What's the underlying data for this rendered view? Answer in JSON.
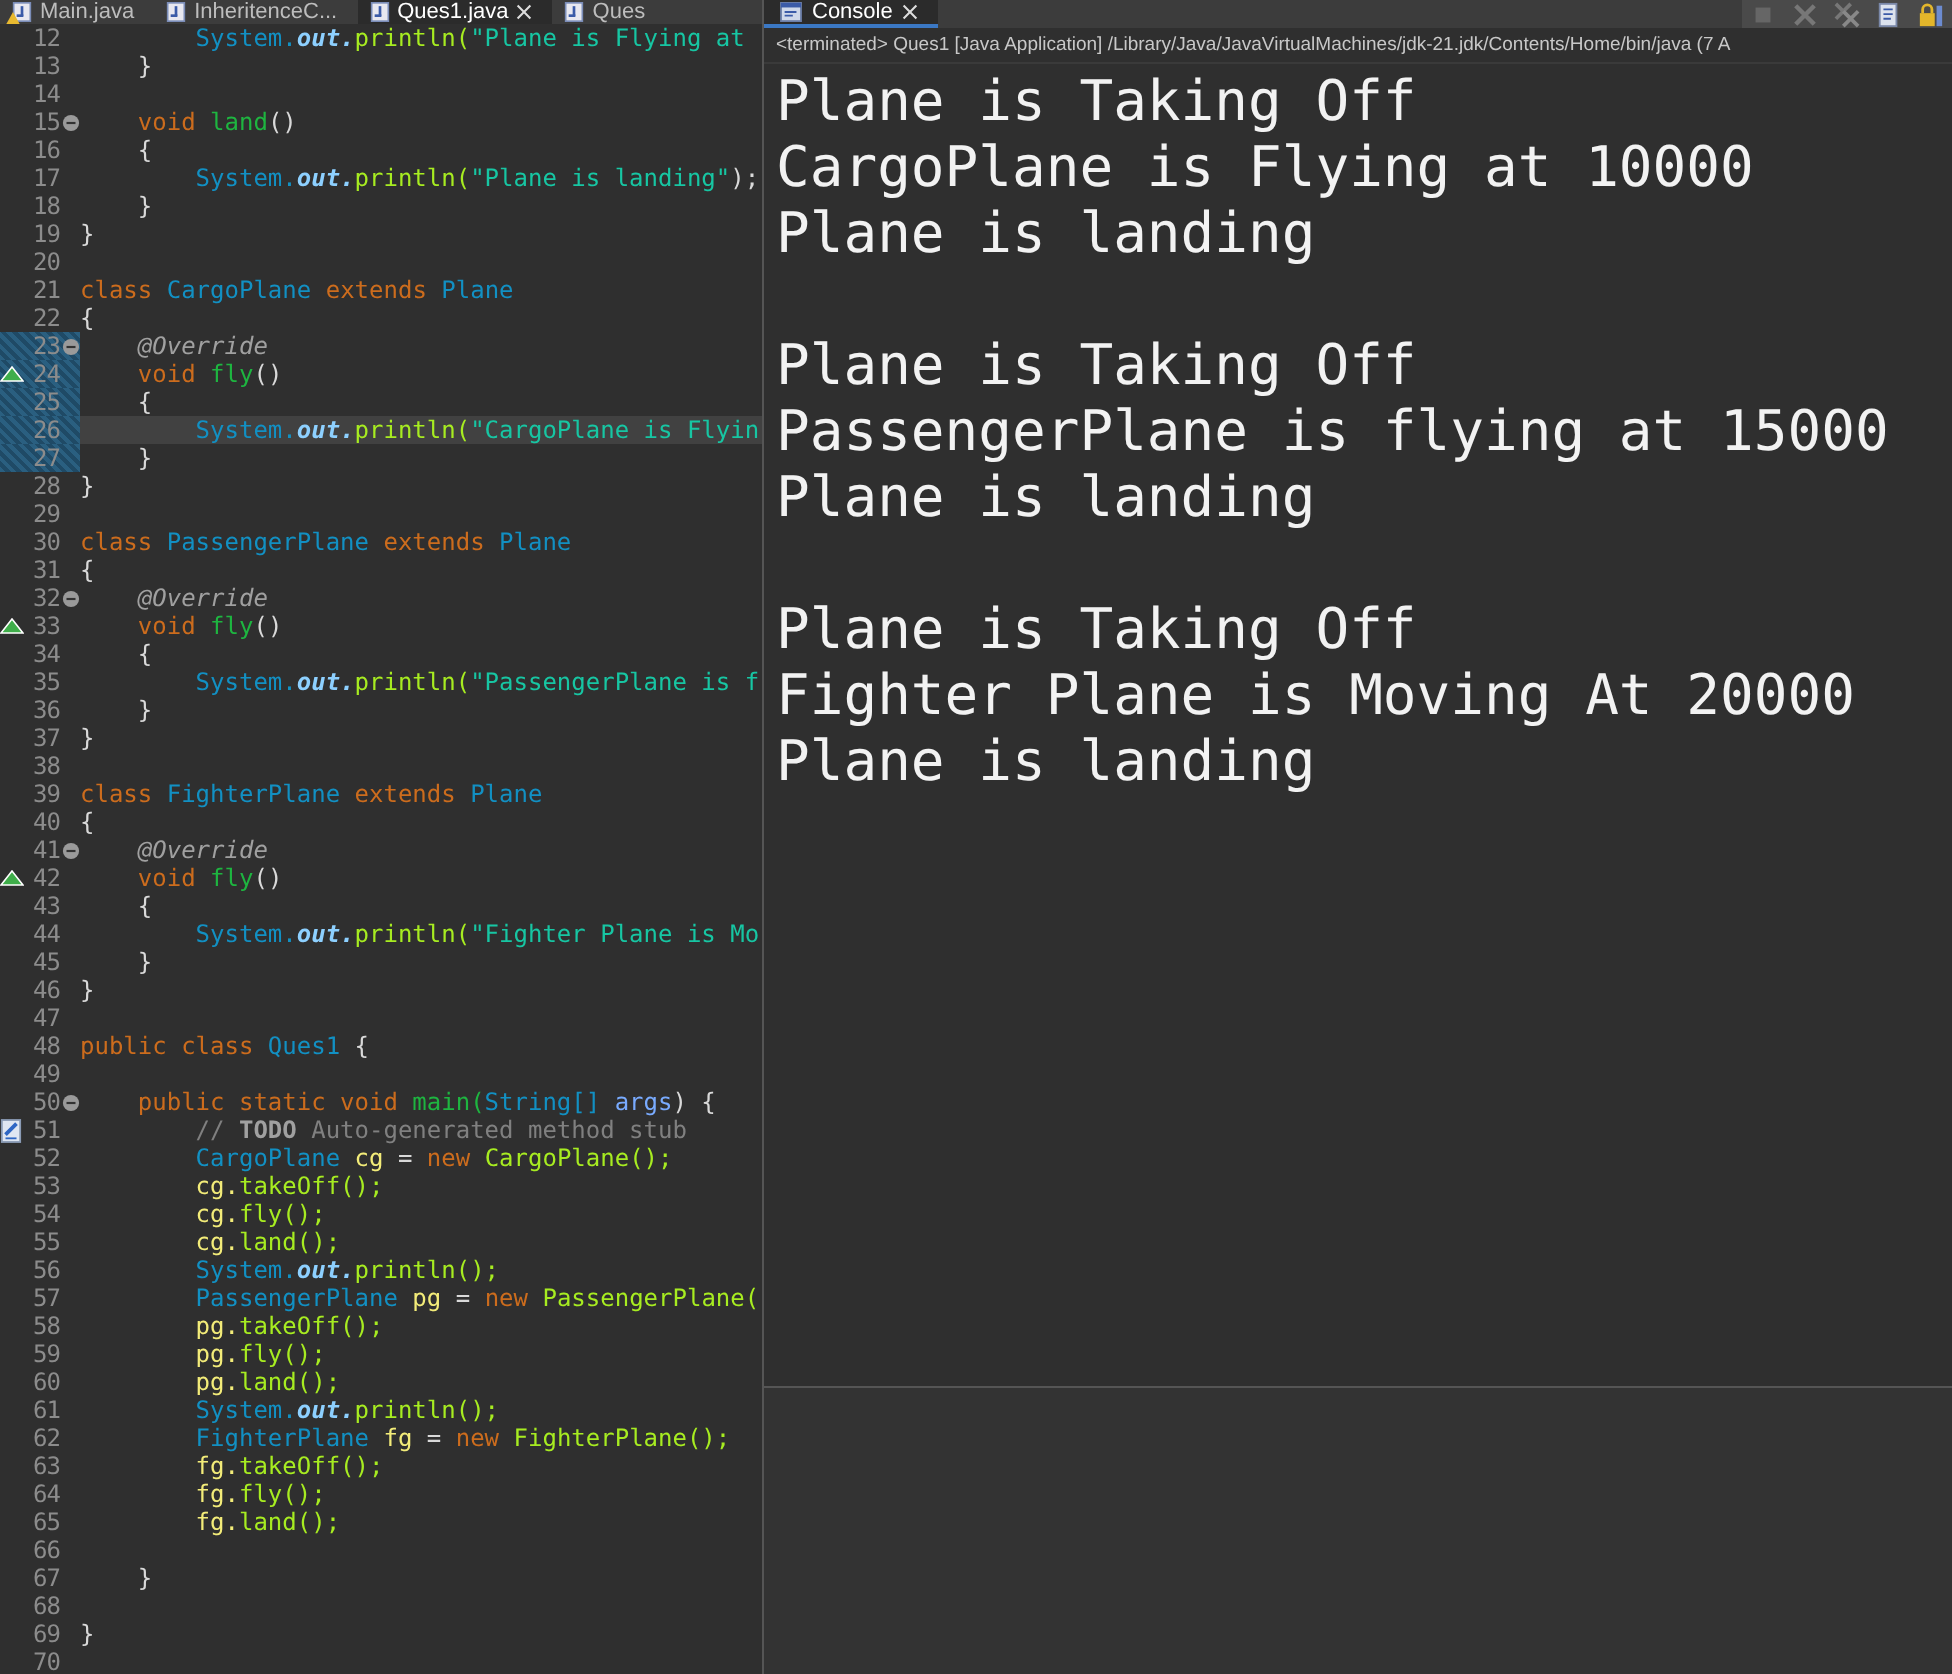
{
  "editor": {
    "tabs": [
      {
        "label": "Main.java",
        "selected": false,
        "warning": true
      },
      {
        "label": "InheritenceC...",
        "selected": false,
        "warning": false
      },
      {
        "label": "Ques1.java",
        "selected": true,
        "warning": false
      },
      {
        "label": "Ques",
        "selected": false,
        "warning": false
      }
    ],
    "lines": [
      {
        "number": "12",
        "kind": "none",
        "changed": false,
        "current": false,
        "tokens": [
          {
            "text": "        System.",
            "kind": "type"
          },
          {
            "text": "out.",
            "kind": "field"
          },
          {
            "text": "println(",
            "kind": "call"
          },
          {
            "text": "\"Plane is Flying at",
            "kind": "str"
          }
        ]
      },
      {
        "number": "13",
        "kind": "none",
        "changed": false,
        "current": false,
        "tokens": [
          {
            "text": "    }",
            "kind": "plain"
          }
        ]
      },
      {
        "number": "14",
        "kind": "none",
        "changed": false,
        "current": false
      },
      {
        "number": "15",
        "kind": "fold",
        "changed": false,
        "current": false,
        "tokens": [
          {
            "text": "    void ",
            "kind": "kw"
          },
          {
            "text": "land",
            "kind": "decl"
          },
          {
            "text": "()",
            "kind": "plain"
          }
        ]
      },
      {
        "number": "16",
        "kind": "none",
        "changed": false,
        "current": false,
        "tokens": [
          {
            "text": "    {",
            "kind": "plain"
          }
        ]
      },
      {
        "number": "17",
        "kind": "none",
        "changed": false,
        "current": false,
        "tokens": [
          {
            "text": "        System.",
            "kind": "type"
          },
          {
            "text": "out.",
            "kind": "field"
          },
          {
            "text": "println(",
            "kind": "call"
          },
          {
            "text": "\"Plane is landing\"",
            "kind": "str"
          },
          {
            "text": ");",
            "kind": "plain"
          }
        ]
      },
      {
        "number": "18",
        "kind": "none",
        "changed": false,
        "current": false,
        "tokens": [
          {
            "text": "    }",
            "kind": "plain"
          }
        ]
      },
      {
        "number": "19",
        "kind": "none",
        "changed": false,
        "current": false,
        "tokens": [
          {
            "text": "}",
            "kind": "plain"
          }
        ]
      },
      {
        "number": "20",
        "kind": "none",
        "changed": false,
        "current": false
      },
      {
        "number": "21",
        "kind": "none",
        "changed": false,
        "current": false,
        "tokens": [
          {
            "text": "class ",
            "kind": "kw"
          },
          {
            "text": "CargoPlane ",
            "kind": "type"
          },
          {
            "text": "extends ",
            "kind": "kw"
          },
          {
            "text": "Plane",
            "kind": "type"
          }
        ]
      },
      {
        "number": "22",
        "kind": "none",
        "changed": false,
        "current": false,
        "tokens": [
          {
            "text": "{",
            "kind": "plain"
          }
        ]
      },
      {
        "number": "23",
        "kind": "fold",
        "changed": true,
        "current": false,
        "tokens": [
          {
            "text": "    @Override",
            "kind": "ann"
          }
        ]
      },
      {
        "number": "24",
        "kind": "override",
        "changed": true,
        "current": false,
        "tokens": [
          {
            "text": "    void ",
            "kind": "kw"
          },
          {
            "text": "fly",
            "kind": "decl"
          },
          {
            "text": "()",
            "kind": "plain"
          }
        ]
      },
      {
        "number": "25",
        "kind": "none",
        "changed": true,
        "current": false,
        "tokens": [
          {
            "text": "    {",
            "kind": "plain"
          }
        ]
      },
      {
        "number": "26",
        "kind": "none",
        "changed": true,
        "current": true,
        "tokens": [
          {
            "text": "        System.",
            "kind": "type"
          },
          {
            "text": "out.",
            "kind": "field"
          },
          {
            "text": "println(",
            "kind": "call"
          },
          {
            "text": "\"CargoPlane is Flyin",
            "kind": "str"
          }
        ]
      },
      {
        "number": "27",
        "kind": "none",
        "changed": true,
        "current": false,
        "tokens": [
          {
            "text": "    }",
            "kind": "plain"
          }
        ]
      },
      {
        "number": "28",
        "kind": "none",
        "changed": false,
        "current": false,
        "tokens": [
          {
            "text": "}",
            "kind": "plain"
          }
        ]
      },
      {
        "number": "29",
        "kind": "none",
        "changed": false,
        "current": false
      },
      {
        "number": "30",
        "kind": "none",
        "changed": false,
        "current": false,
        "tokens": [
          {
            "text": "class ",
            "kind": "kw"
          },
          {
            "text": "PassengerPlane ",
            "kind": "type"
          },
          {
            "text": "extends ",
            "kind": "kw"
          },
          {
            "text": "Plane",
            "kind": "type"
          }
        ]
      },
      {
        "number": "31",
        "kind": "none",
        "changed": false,
        "current": false,
        "tokens": [
          {
            "text": "{",
            "kind": "plain"
          }
        ]
      },
      {
        "number": "32",
        "kind": "fold",
        "changed": false,
        "current": false,
        "tokens": [
          {
            "text": "    @Override",
            "kind": "ann"
          }
        ]
      },
      {
        "number": "33",
        "kind": "override",
        "changed": false,
        "current": false,
        "tokens": [
          {
            "text": "    void ",
            "kind": "kw"
          },
          {
            "text": "fly",
            "kind": "decl"
          },
          {
            "text": "()",
            "kind": "plain"
          }
        ]
      },
      {
        "number": "34",
        "kind": "none",
        "changed": false,
        "current": false,
        "tokens": [
          {
            "text": "    {",
            "kind": "plain"
          }
        ]
      },
      {
        "number": "35",
        "kind": "none",
        "changed": false,
        "current": false,
        "tokens": [
          {
            "text": "        System.",
            "kind": "type"
          },
          {
            "text": "out.",
            "kind": "field"
          },
          {
            "text": "println(",
            "kind": "call"
          },
          {
            "text": "\"PassengerPlane is f",
            "kind": "str"
          }
        ]
      },
      {
        "number": "36",
        "kind": "none",
        "changed": false,
        "current": false,
        "tokens": [
          {
            "text": "    }",
            "kind": "plain"
          }
        ]
      },
      {
        "number": "37",
        "kind": "none",
        "changed": false,
        "current": false,
        "tokens": [
          {
            "text": "}",
            "kind": "plain"
          }
        ]
      },
      {
        "number": "38",
        "kind": "none",
        "changed": false,
        "current": false
      },
      {
        "number": "39",
        "kind": "none",
        "changed": false,
        "current": false,
        "tokens": [
          {
            "text": "class ",
            "kind": "kw"
          },
          {
            "text": "FighterPlane ",
            "kind": "type"
          },
          {
            "text": "extends ",
            "kind": "kw"
          },
          {
            "text": "Plane",
            "kind": "type"
          }
        ]
      },
      {
        "number": "40",
        "kind": "none",
        "changed": false,
        "current": false,
        "tokens": [
          {
            "text": "{",
            "kind": "plain"
          }
        ]
      },
      {
        "number": "41",
        "kind": "fold",
        "changed": false,
        "current": false,
        "tokens": [
          {
            "text": "    @Override",
            "kind": "ann"
          }
        ]
      },
      {
        "number": "42",
        "kind": "override",
        "changed": false,
        "current": false,
        "tokens": [
          {
            "text": "    void ",
            "kind": "kw"
          },
          {
            "text": "fly",
            "kind": "decl"
          },
          {
            "text": "()",
            "kind": "plain"
          }
        ]
      },
      {
        "number": "43",
        "kind": "none",
        "changed": false,
        "current": false,
        "tokens": [
          {
            "text": "    {",
            "kind": "plain"
          }
        ]
      },
      {
        "number": "44",
        "kind": "none",
        "changed": false,
        "current": false,
        "tokens": [
          {
            "text": "        System.",
            "kind": "type"
          },
          {
            "text": "out.",
            "kind": "field"
          },
          {
            "text": "println(",
            "kind": "call"
          },
          {
            "text": "\"Fighter Plane is Mo",
            "kind": "str"
          }
        ]
      },
      {
        "number": "45",
        "kind": "none",
        "changed": false,
        "current": false,
        "tokens": [
          {
            "text": "    }",
            "kind": "plain"
          }
        ]
      },
      {
        "number": "46",
        "kind": "none",
        "changed": false,
        "current": false,
        "tokens": [
          {
            "text": "}",
            "kind": "plain"
          }
        ]
      },
      {
        "number": "47",
        "kind": "none",
        "changed": false,
        "current": false
      },
      {
        "number": "48",
        "kind": "none",
        "changed": false,
        "current": false,
        "tokens": [
          {
            "text": "public class ",
            "kind": "kw"
          },
          {
            "text": "Ques1",
            "kind": "type"
          },
          {
            "text": " {",
            "kind": "plain"
          }
        ]
      },
      {
        "number": "49",
        "kind": "none",
        "changed": false,
        "current": false
      },
      {
        "number": "50",
        "kind": "fold",
        "changed": false,
        "current": false,
        "tokens": [
          {
            "text": "    public static void ",
            "kind": "kw"
          },
          {
            "text": "main(",
            "kind": "decl"
          },
          {
            "text": "String[] ",
            "kind": "type"
          },
          {
            "text": "args",
            "kind": "param"
          },
          {
            "text": ") {",
            "kind": "plain"
          }
        ]
      },
      {
        "number": "51",
        "kind": "task",
        "changed": false,
        "current": false,
        "tokens": [
          {
            "text": "        //",
            "kind": "comment"
          },
          {
            "text": "TODO",
            "kind": "todo"
          },
          {
            "text": "Auto-generated method stub",
            "kind": "comment"
          }
        ]
      },
      {
        "number": "52",
        "kind": "none",
        "changed": false,
        "current": false,
        "tokens": [
          {
            "text": "        CargoPlane ",
            "kind": "type"
          },
          {
            "text": "cg",
            "kind": "var"
          },
          {
            "text": " = ",
            "kind": "plain"
          },
          {
            "text": "new ",
            "kind": "kw"
          },
          {
            "text": "CargoPlane();",
            "kind": "call"
          }
        ]
      },
      {
        "number": "53",
        "kind": "none",
        "changed": false,
        "current": false,
        "tokens": [
          {
            "text": "        cg.",
            "kind": "var"
          },
          {
            "text": "takeOff();",
            "kind": "call"
          }
        ]
      },
      {
        "number": "54",
        "kind": "none",
        "changed": false,
        "current": false,
        "tokens": [
          {
            "text": "        cg.",
            "kind": "var"
          },
          {
            "text": "fly();",
            "kind": "call"
          }
        ]
      },
      {
        "number": "55",
        "kind": "none",
        "changed": false,
        "current": false,
        "tokens": [
          {
            "text": "        cg.",
            "kind": "var"
          },
          {
            "text": "land();",
            "kind": "call"
          }
        ]
      },
      {
        "number": "56",
        "kind": "none",
        "changed": false,
        "current": false,
        "tokens": [
          {
            "text": "        System.",
            "kind": "type"
          },
          {
            "text": "out.",
            "kind": "field"
          },
          {
            "text": "println();",
            "kind": "call"
          }
        ]
      },
      {
        "number": "57",
        "kind": "none",
        "changed": false,
        "current": false,
        "tokens": [
          {
            "text": "        PassengerPlane ",
            "kind": "type"
          },
          {
            "text": "pg",
            "kind": "var"
          },
          {
            "text": " = ",
            "kind": "plain"
          },
          {
            "text": "new ",
            "kind": "kw"
          },
          {
            "text": "PassengerPlane(",
            "kind": "call"
          }
        ]
      },
      {
        "number": "58",
        "kind": "none",
        "changed": false,
        "current": false,
        "tokens": [
          {
            "text": "        pg.",
            "kind": "var"
          },
          {
            "text": "takeOff();",
            "kind": "call"
          }
        ]
      },
      {
        "number": "59",
        "kind": "none",
        "changed": false,
        "current": false,
        "tokens": [
          {
            "text": "        pg.",
            "kind": "var"
          },
          {
            "text": "fly();",
            "kind": "call"
          }
        ]
      },
      {
        "number": "60",
        "kind": "none",
        "changed": false,
        "current": false,
        "tokens": [
          {
            "text": "        pg.",
            "kind": "var"
          },
          {
            "text": "land();",
            "kind": "call"
          }
        ]
      },
      {
        "number": "61",
        "kind": "none",
        "changed": false,
        "current": false,
        "tokens": [
          {
            "text": "        System.",
            "kind": "type"
          },
          {
            "text": "out.",
            "kind": "field"
          },
          {
            "text": "println();",
            "kind": "call"
          }
        ]
      },
      {
        "number": "62",
        "kind": "none",
        "changed": false,
        "current": false,
        "tokens": [
          {
            "text": "        FighterPlane ",
            "kind": "type"
          },
          {
            "text": "fg",
            "kind": "var"
          },
          {
            "text": " = ",
            "kind": "plain"
          },
          {
            "text": "new ",
            "kind": "kw"
          },
          {
            "text": "FighterPlane();",
            "kind": "call"
          }
        ]
      },
      {
        "number": "63",
        "kind": "none",
        "changed": false,
        "current": false,
        "tokens": [
          {
            "text": "        fg.",
            "kind": "var"
          },
          {
            "text": "takeOff();",
            "kind": "call"
          }
        ]
      },
      {
        "number": "64",
        "kind": "none",
        "changed": false,
        "current": false,
        "tokens": [
          {
            "text": "        fg.",
            "kind": "var"
          },
          {
            "text": "fly();",
            "kind": "call"
          }
        ]
      },
      {
        "number": "65",
        "kind": "none",
        "changed": false,
        "current": false,
        "tokens": [
          {
            "text": "        fg.",
            "kind": "var"
          },
          {
            "text": "land();",
            "kind": "call"
          }
        ]
      },
      {
        "number": "66",
        "kind": "none",
        "changed": false,
        "current": false
      },
      {
        "number": "67",
        "kind": "none",
        "changed": false,
        "current": false,
        "tokens": [
          {
            "text": "    }",
            "kind": "plain"
          }
        ]
      },
      {
        "number": "68",
        "kind": "none",
        "changed": false,
        "current": false
      },
      {
        "number": "69",
        "kind": "none",
        "changed": false,
        "current": false,
        "tokens": [
          {
            "text": "}",
            "kind": "plain"
          }
        ]
      },
      {
        "number": "70",
        "kind": "none",
        "changed": false,
        "current": false
      }
    ]
  },
  "console": {
    "tabs": [
      {
        "label": "Console",
        "selected": true
      }
    ],
    "header": "<terminated> Ques1 [Java Application] /Library/Java/JavaVirtualMachines/jdk-21.jdk/Contents/Home/bin/java  (7 A",
    "output": [
      [
        "Plane is Taking Off",
        "CargoPlane is Flying at 10000",
        "Plane is landing"
      ],
      [
        "Plane is Taking Off",
        "PassengerPlane is flying at 15000",
        "Plane is landing"
      ],
      [
        "Plane is Taking Off",
        "Fighter Plane is Moving At 20000",
        "Plane is landing"
      ]
    ]
  }
}
